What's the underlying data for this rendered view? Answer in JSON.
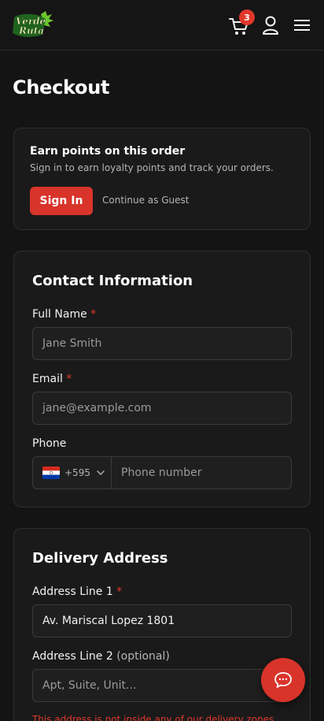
{
  "header": {
    "logo_text": "Verde Ruta",
    "cart_count": "3"
  },
  "page_title": "Checkout",
  "loyalty": {
    "title": "Earn points on this order",
    "subtitle": "Sign in to earn loyalty points and track your orders.",
    "sign_in_label": "Sign In",
    "guest_label": "Continue as Guest"
  },
  "contact": {
    "title": "Contact Information",
    "full_name_label": "Full Name",
    "full_name_placeholder": "Jane Smith",
    "email_label": "Email",
    "email_placeholder": "jane@example.com",
    "phone_label": "Phone",
    "phone_country_code": "+595",
    "phone_placeholder": "Phone number",
    "required_mark": "*"
  },
  "delivery": {
    "title": "Delivery Address",
    "address1_label": "Address Line 1",
    "address1_value": "Av. Mariscal Lopez 1801",
    "address2_label": "Address Line 2",
    "address2_optional": "(optional)",
    "address2_placeholder": "Apt, Suite, Unit...",
    "error_text": "This address is not inside any of our delivery zones."
  },
  "colors": {
    "accent": "#d8342a",
    "background": "#141414",
    "card": "#1a1a1a",
    "logo_green": "#5fbf2a"
  },
  "icons": {
    "cart": "cart-icon",
    "user": "user-icon",
    "menu": "hamburger-menu-icon",
    "chat": "chat-bubble-icon",
    "flag": "paraguay-flag-icon"
  }
}
